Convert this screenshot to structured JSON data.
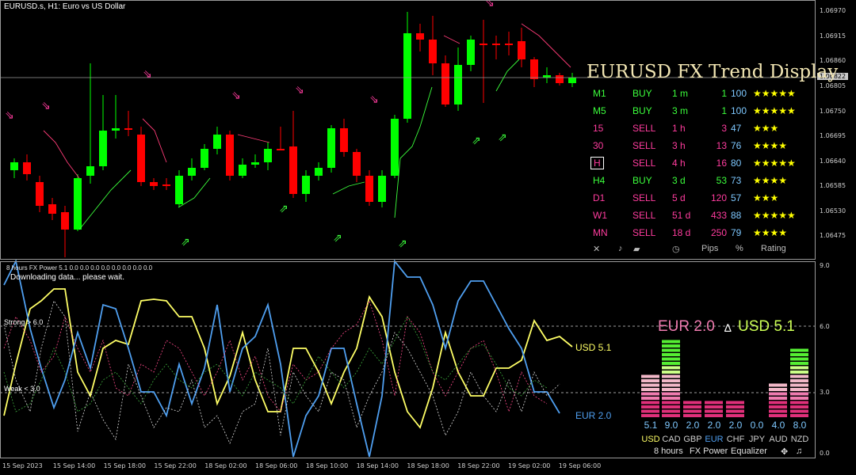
{
  "main_chart": {
    "header": "EURUSD.s, H1:  Euro vs US Dollar",
    "current_price": "1.06822",
    "price_levels": [
      "1.06970",
      "1.06915",
      "1.06860",
      "1.06805",
      "1.06750",
      "1.06695",
      "1.06640",
      "1.06585",
      "1.06530",
      "1.06475"
    ]
  },
  "trend_display": {
    "title": "EURUSD FX Trend Display",
    "rows": [
      {
        "tf": "M1",
        "signal": "BUY",
        "time": "1 m",
        "pips": "1",
        "pct": "100",
        "stars": "★★★★★",
        "color": "#3cff3c"
      },
      {
        "tf": "M5",
        "signal": "BUY",
        "time": "3 m",
        "pips": "1",
        "pct": "100",
        "stars": "★★★★★",
        "color": "#3cff3c"
      },
      {
        "tf": "15",
        "signal": "SELL",
        "time": "1 h",
        "pips": "3",
        "pct": "47",
        "stars": "★★★",
        "color": "#ff3c9e"
      },
      {
        "tf": "30",
        "signal": "SELL",
        "time": "3 h",
        "pips": "13",
        "pct": "76",
        "stars": "★★★★",
        "color": "#ff3c9e"
      },
      {
        "tf": "H",
        "signal": "SELL",
        "time": "4 h",
        "pips": "16",
        "pct": "80",
        "stars": "★★★★★",
        "color": "#ff3c9e"
      },
      {
        "tf": "H4",
        "signal": "BUY",
        "time": "3 d",
        "pips": "53",
        "pct": "73",
        "stars": "★★★★",
        "color": "#3cff3c"
      },
      {
        "tf": "D1",
        "signal": "SELL",
        "time": "5 d",
        "pips": "120",
        "pct": "57",
        "stars": "★★★",
        "color": "#ff3c9e"
      },
      {
        "tf": "W1",
        "signal": "SELL",
        "time": "51 d",
        "pips": "433",
        "pct": "88",
        "stars": "★★★★★",
        "color": "#ff3c9e"
      },
      {
        "tf": "MN",
        "signal": "SELL",
        "time": "18 d",
        "pips": "250",
        "pct": "79",
        "stars": "★★★★",
        "color": "#ff3c9e"
      }
    ],
    "footer": {
      "close": "✕",
      "sound": "♪",
      "clock": "◷",
      "pips": "Pips",
      "pct": "%",
      "rating": "Rating"
    }
  },
  "indicator": {
    "header": "8 hours FX Power 5.1 0.0 0.0 0.0 0.0 0.0 0.0 0.0 0.0",
    "status": "Downloading data... please wait.",
    "strong_label": "Strong > 6.0",
    "weak_label": "Weak < 3.0",
    "levels": [
      "9.0",
      "6.0",
      "3.0",
      "0.0"
    ],
    "usd_label": "USD 5.1",
    "eur_label": "EUR 2.0",
    "eur_big": "EUR 2.0",
    "delta": "∆",
    "usd_big": "USD 5.1"
  },
  "equalizer": {
    "currencies": [
      {
        "name": "USD",
        "value": "5.1",
        "v": 5.1
      },
      {
        "name": "CAD",
        "value": "9.0",
        "v": 9.0
      },
      {
        "name": "GBP",
        "value": "2.0",
        "v": 2.0
      },
      {
        "name": "EUR",
        "value": "2.0",
        "v": 2.0
      },
      {
        "name": "CHF",
        "value": "2.0",
        "v": 2.0
      },
      {
        "name": "JPY",
        "value": "0.0",
        "v": 0.0
      },
      {
        "name": "AUD",
        "value": "4.0",
        "v": 4.0
      },
      {
        "name": "NZD",
        "value": "8.0",
        "v": 8.0
      }
    ],
    "footer": {
      "period": "8 hours",
      "title": "FX Power",
      "mode": "Equalizer",
      "move": "✥",
      "sound": "♫"
    }
  },
  "time_axis": [
    "15 Sep 2023",
    "15 Sep 14:00",
    "15 Sep 18:00",
    "15 Sep 22:00",
    "18 Sep 02:00",
    "18 Sep 06:00",
    "18 Sep 10:00",
    "18 Sep 14:00",
    "18 Sep 18:00",
    "18 Sep 22:00",
    "19 Sep 02:00",
    "19 Sep 06:00"
  ],
  "colors": {
    "bull": "#00ff00",
    "bear": "#ff0000",
    "usd": "#ffff66",
    "eur": "#4f9ff0",
    "buy": "#3cff3c",
    "sell": "#ff3c9e",
    "stars": "#ffff00"
  }
}
